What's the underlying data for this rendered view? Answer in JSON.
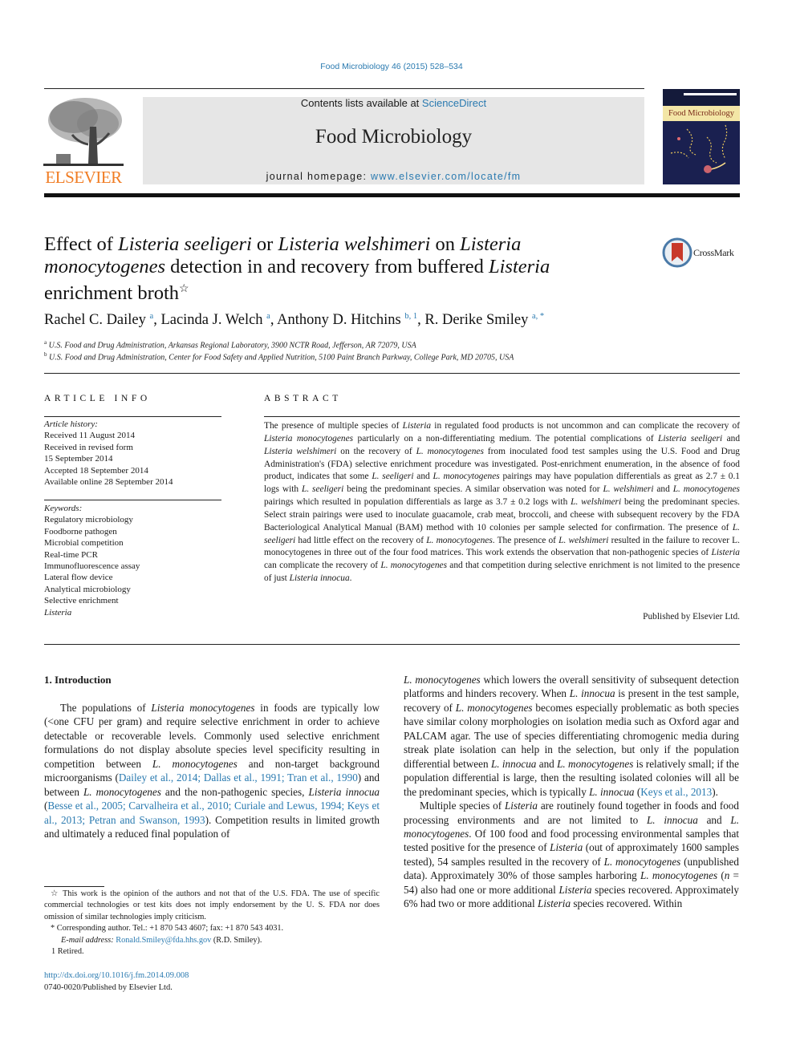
{
  "header": {
    "citation": "Food Microbiology 46 (2015) 528–534",
    "publisher_logo_text": "ELSEVIER",
    "contents_prefix": "Contents lists available at ",
    "contents_link": "ScienceDirect",
    "journal_title": "Food Microbiology",
    "homepage_prefix": "journal homepage: ",
    "homepage_link": "www.elsevier.com/locate/fm",
    "cover_title": "Food Microbiology",
    "colors": {
      "link": "#2a7ab0",
      "elsevier_orange": "#f07c23",
      "banner_bg": "#e6e6e6"
    }
  },
  "article": {
    "title": [
      {
        "t": "Effect of "
      },
      {
        "t": "Listeria seeligeri",
        "s": "i"
      },
      {
        "t": " or "
      },
      {
        "t": "Listeria welshimeri",
        "s": "i"
      },
      {
        "t": " on "
      },
      {
        "t": "Listeria",
        "s": "i"
      },
      {
        "t": " "
      },
      {
        "t": "monocytogenes",
        "s": "i"
      },
      {
        "t": " detection in and recovery from buffered "
      },
      {
        "t": "Listeria",
        "s": "i"
      },
      {
        "t": " enrichment broth"
      }
    ],
    "title_note_marker": "☆",
    "crossmark_label": "CrossMark",
    "authors": [
      {
        "name": "Rachel C. Dailey",
        "sup": "a"
      },
      {
        "name": "Lacinda J. Welch",
        "sup": "a"
      },
      {
        "name": "Anthony D. Hitchins",
        "sup": "b, 1"
      },
      {
        "name": "R. Derike Smiley",
        "sup": "a, *"
      }
    ],
    "affiliations": [
      {
        "key": "a",
        "text": "U.S. Food and Drug Administration, Arkansas Regional Laboratory, 3900 NCTR Road, Jefferson, AR 72079, USA"
      },
      {
        "key": "b",
        "text": "U.S. Food and Drug Administration, Center for Food Safety and Applied Nutrition, 5100 Paint Branch Parkway, College Park, MD 20705, USA"
      }
    ]
  },
  "article_info": {
    "heading": "ARTICLE INFO",
    "history_label": "Article history:",
    "history": [
      "Received 11 August 2014",
      "Received in revised form",
      "15 September 2014",
      "Accepted 18 September 2014",
      "Available online 28 September 2014"
    ],
    "keywords_label": "Keywords:",
    "keywords": [
      "Regulatory microbiology",
      "Foodborne pathogen",
      "Microbial competition",
      "Real-time PCR",
      "Immunofluorescence assay",
      "Lateral flow device",
      "Analytical microbiology",
      "Selective enrichment",
      "Listeria"
    ]
  },
  "abstract": {
    "heading": "ABSTRACT",
    "body": [
      {
        "t": "The presence of multiple species of "
      },
      {
        "t": "Listeria",
        "s": "i"
      },
      {
        "t": " in regulated food products is not uncommon and can complicate the recovery of "
      },
      {
        "t": "Listeria monocytogenes",
        "s": "i"
      },
      {
        "t": " particularly on a non-differentiating medium. The potential complications of "
      },
      {
        "t": "Listeria seeligeri",
        "s": "i"
      },
      {
        "t": " and "
      },
      {
        "t": "Listeria welshimeri",
        "s": "i"
      },
      {
        "t": " on the recovery of "
      },
      {
        "t": "L. monocytogenes",
        "s": "i"
      },
      {
        "t": " from inoculated food test samples using the U.S. Food and Drug Administration's (FDA) selective enrichment procedure was investigated. Post-enrichment enumeration, in the absence of food product, indicates that some "
      },
      {
        "t": "L. seeligeri",
        "s": "i"
      },
      {
        "t": " and "
      },
      {
        "t": "L. monocytogenes",
        "s": "i"
      },
      {
        "t": " pairings may have population differentials as great as 2.7 ± 0.1 logs with "
      },
      {
        "t": "L. seeligeri",
        "s": "i"
      },
      {
        "t": " being the predominant species. A similar observation was noted for "
      },
      {
        "t": "L. welshimeri",
        "s": "i"
      },
      {
        "t": " and "
      },
      {
        "t": "L. monocytogenes",
        "s": "i"
      },
      {
        "t": " pairings which resulted in population differentials as large as 3.7 ± 0.2 logs with "
      },
      {
        "t": "L. welshimeri",
        "s": "i"
      },
      {
        "t": " being the predominant species. Select strain pairings were used to inoculate guacamole, crab meat, broccoli, and cheese with subsequent recovery by the FDA Bacteriological Analytical Manual (BAM) method with 10 colonies per sample selected for confirmation. The presence of "
      },
      {
        "t": "L. seeligeri",
        "s": "i"
      },
      {
        "t": " had little effect on the recovery of "
      },
      {
        "t": "L. monocytogenes",
        "s": "i"
      },
      {
        "t": ". The presence of "
      },
      {
        "t": "L. welshimeri",
        "s": "i"
      },
      {
        "t": " resulted in the failure to recover L. monocytogenes in three out of the four food matrices. This work extends the observation that non-pathogenic species of "
      },
      {
        "t": "Listeria",
        "s": "i"
      },
      {
        "t": " can complicate the recovery of "
      },
      {
        "t": "L. monocytogenes",
        "s": "i"
      },
      {
        "t": " and that competition during selective enrichment is not limited to the presence of just "
      },
      {
        "t": "Listeria innocua",
        "s": "i"
      },
      {
        "t": "."
      }
    ],
    "published_by": "Published by Elsevier Ltd."
  },
  "introduction": {
    "heading": "1.  Introduction",
    "col1_paragraphs": [
      [
        {
          "t": "The populations of "
        },
        {
          "t": "Listeria monocytogenes",
          "s": "i"
        },
        {
          "t": " in foods are typically low (<one CFU per gram) and require selective enrichment in order to achieve detectable or recoverable levels. Commonly used selec­tive enrichment formulations do not display absolute species level specificity resulting in competition between "
        },
        {
          "t": "L. monocytogenes",
          "s": "i"
        },
        {
          "t": " and non-target background microorganisms ("
        },
        {
          "t": "Dailey et al., 2014; Dallas et al., 1991; Tran et al., 1990",
          "s": "l"
        },
        {
          "t": ") and between "
        },
        {
          "t": "L. monocytogenes",
          "s": "i"
        },
        {
          "t": " and the non-pathogenic species, "
        },
        {
          "t": "Listeria innocua",
          "s": "i"
        },
        {
          "t": " ("
        },
        {
          "t": "Besse et al., 2005; Carvalheira et al., 2010; Curiale and Lewus, 1994; Keys et al., 2013; Petran and Swanson, 1993",
          "s": "l"
        },
        {
          "t": "). Competition results in limited growth and ultimately a reduced final population of"
        }
      ]
    ],
    "col2_paragraphs": [
      [
        {
          "t": "L. monocytogenes",
          "s": "i"
        },
        {
          "t": " which lowers the overall sensitivity of subsequent detection platforms and hinders recovery. When "
        },
        {
          "t": "L. innocua",
          "s": "i"
        },
        {
          "t": " is pre­sent in the test sample, recovery of "
        },
        {
          "t": "L. monocytogenes",
          "s": "i"
        },
        {
          "t": " becomes especially problematic as both species have similar colony mor­phologies on isolation media such as Oxford agar and PALCAM agar. The use of species differentiating chromogenic media during streak plate isolation can help in the selection, but only if the population differential between "
        },
        {
          "t": "L. innocua",
          "s": "i"
        },
        {
          "t": " and "
        },
        {
          "t": "L. monocytogenes",
          "s": "i"
        },
        {
          "t": " is relatively small; if the population differential is large, then the resulting isolated colonies will all be the predominant species, which is typically "
        },
        {
          "t": "L. innocua",
          "s": "i"
        },
        {
          "t": " ("
        },
        {
          "t": "Keys et al., 2013",
          "s": "l"
        },
        {
          "t": ")."
        }
      ],
      [
        {
          "t": "Multiple species of "
        },
        {
          "t": "Listeria",
          "s": "i"
        },
        {
          "t": " are routinely found together in foods and food processing environments and are not limited to "
        },
        {
          "t": "L. innocua",
          "s": "i"
        },
        {
          "t": " and "
        },
        {
          "t": "L. monocytogenes",
          "s": "i"
        },
        {
          "t": ". Of 100 food and food processing environ­mental samples that tested positive for the presence of "
        },
        {
          "t": "Listeria",
          "s": "i"
        },
        {
          "t": " (out of approximately 1600 samples tested), 54 samples resulted in the recovery of "
        },
        {
          "t": "L. monocytogenes",
          "s": "i"
        },
        {
          "t": " (unpublished data). Approximately 30% of those samples harboring "
        },
        {
          "t": "L. monocytogenes",
          "s": "i"
        },
        {
          "t": " ("
        },
        {
          "t": "n",
          "s": "i"
        },
        {
          "t": " = 54) also had one or more additional "
        },
        {
          "t": "Listeria",
          "s": "i"
        },
        {
          "t": " species recovered. Approximately 6% had two or more additional "
        },
        {
          "t": "Listeria",
          "s": "i"
        },
        {
          "t": " species recovered. Within"
        }
      ]
    ]
  },
  "footnotes": {
    "items": [
      [
        {
          "t": "☆ This work is the opinion of the authors and not that of the U.S. FDA. The use of specific commercial technologies or test kits does not imply endorsement by the U. S. FDA nor does omission of similar technologies imply criticism."
        }
      ],
      [
        {
          "t": "* Corresponding author. Tel.: +1 870 543 4607; fax: +1 870 543 4031."
        }
      ],
      [
        {
          "t": "E-mail address:",
          "s": "i"
        },
        {
          "t": " "
        },
        {
          "t": "Ronald.Smiley@fda.hhs.gov",
          "s": "l"
        },
        {
          "t": " (R.D. Smiley)."
        }
      ],
      [
        {
          "t": "1  Retired."
        }
      ]
    ],
    "doi": "http://dx.doi.org/10.1016/j.fm.2014.09.008",
    "issn": "0740-0020/Published by Elsevier Ltd."
  }
}
